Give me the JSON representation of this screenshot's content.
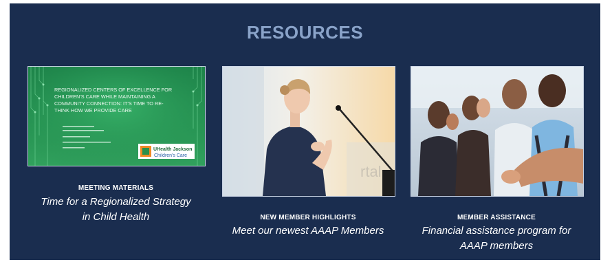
{
  "section": {
    "title": "RESOURCES"
  },
  "cards": [
    {
      "label": "MEETING MATERIALS",
      "desc_line1": "Time for a Regionalized Strategy",
      "desc_line2": "in Child Health",
      "slide": {
        "title_lines": [
          "REGIONALIZED CENTERS OF EXCELLENCE FOR",
          "CHILDREN'S CARE WHILE MAINTAINING A",
          "COMMUNITY CONNECTION: IT'S TIME TO RE-",
          "THINK HOW WE PROVIDE CARE"
        ],
        "logo_text_top": "UHealth Jackson",
        "logo_text_bottom": "Children's Care"
      }
    },
    {
      "label": "NEW MEMBER HIGHLIGHTS",
      "desc_line1": "Meet our newest AAAP Members",
      "desc_line2": ""
    },
    {
      "label": "MEMBER ASSISTANCE",
      "desc_line1": "Financial assistance program for",
      "desc_line2": "AAAP members"
    }
  ],
  "colors": {
    "background": "#1a2d4f",
    "title": "#8aa3c9",
    "text": "#ffffff"
  }
}
